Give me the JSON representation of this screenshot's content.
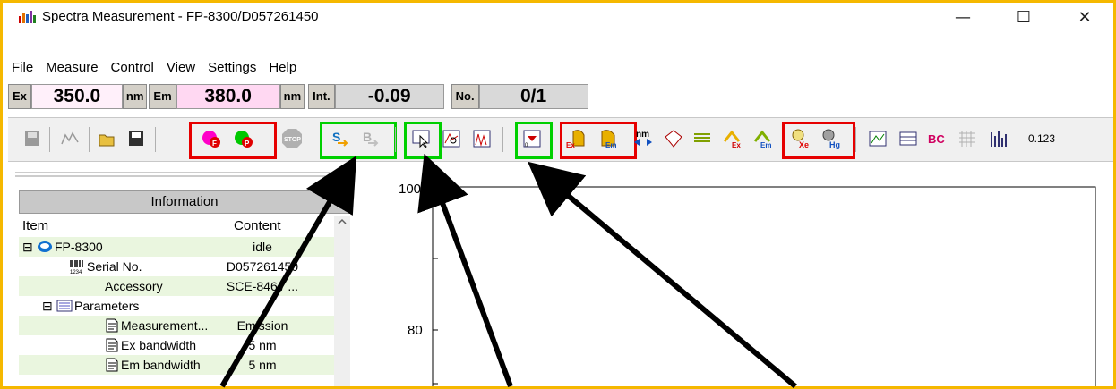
{
  "window": {
    "title": "Spectra Measurement - FP-8300/D057261450",
    "minimize_glyph": "—",
    "maximize_glyph": "☐",
    "close_glyph": "✕"
  },
  "menu": [
    "File",
    "Measure",
    "Control",
    "View",
    "Settings",
    "Help"
  ],
  "status": {
    "ex_label": "Ex",
    "ex_value": "350.0",
    "ex_unit": "nm",
    "em_label": "Em",
    "em_value": "380.0",
    "em_unit": "nm",
    "int_label": "Int.",
    "int_value": "-0.09",
    "no_label": "No.",
    "no_value": "0/1",
    "colors": {
      "ex_bg": "#fff0fa",
      "em_bg": "#ffd8f2",
      "int_bg": "#d9d9d9",
      "no_bg": "#d9d9d9"
    }
  },
  "toolbar": {
    "stop_label": "STOP",
    "zoom_label": "0.123"
  },
  "panel": {
    "header": "Information",
    "col_item": "Item",
    "col_content": "Content",
    "rows": [
      {
        "item": "FP-8300",
        "content": "idle"
      },
      {
        "item": "Serial No.",
        "content": "D057261450"
      },
      {
        "item": "Accessory",
        "content": "SCE-846 / ..."
      },
      {
        "item": "Parameters",
        "content": ""
      },
      {
        "item": "Measurement...",
        "content": "Emission"
      },
      {
        "item": "Ex bandwidth",
        "content": "5 nm"
      },
      {
        "item": "Em bandwidth",
        "content": "5 nm"
      }
    ]
  },
  "chart_data": {
    "type": "line",
    "y_ticks": [
      "100",
      "80"
    ]
  },
  "highlight_colors": {
    "red": "#e60000",
    "green": "#00d000",
    "border": "#f5b800"
  }
}
